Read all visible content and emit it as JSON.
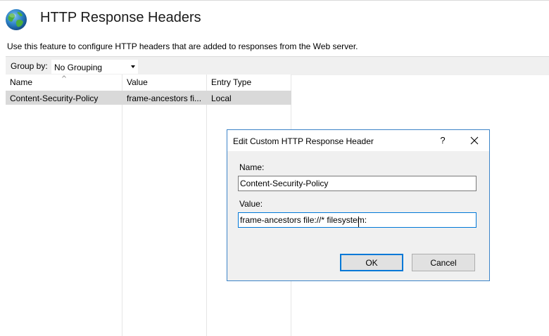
{
  "page": {
    "title": "HTTP Response Headers",
    "description": "Use this feature to configure HTTP headers that are added to responses from the Web server."
  },
  "group_by": {
    "label": "Group by:",
    "selected": "No Grouping"
  },
  "table": {
    "columns": [
      "Name",
      "Value",
      "Entry Type"
    ],
    "rows": [
      {
        "name": "Content-Security-Policy",
        "value": "frame-ancestors fi...",
        "entry_type": "Local"
      }
    ]
  },
  "dialog": {
    "title": "Edit Custom HTTP Response Header",
    "help_glyph": "?",
    "name_label": "Name:",
    "name_value": "Content-Security-Policy",
    "value_label": "Value:",
    "value_value": "frame-ancestors file://* filesystem:",
    "ok_label": "OK",
    "cancel_label": "Cancel"
  },
  "icons": {
    "page_icon": "globe-icon",
    "close": "close-icon",
    "help": "help-icon",
    "dropdown": "chevron-down-icon",
    "sort": "sort-ascending-icon"
  },
  "colors": {
    "selected_row": "#d9d9d9",
    "dialog_border": "#3c84c8",
    "focus_border": "#0078d7"
  }
}
